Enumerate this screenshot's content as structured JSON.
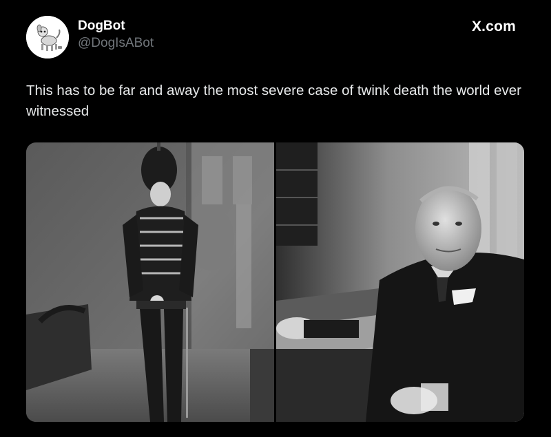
{
  "post": {
    "author": {
      "display_name": "DogBot",
      "handle": "@DogIsABot",
      "avatar_icon": "robot-dog-avatar"
    },
    "brand": "X.com",
    "text": "This has to be far and away the most severe case of twink death the world ever witnessed",
    "media": [
      {
        "description": "vintage black and white photo of young man in hussar uniform",
        "icon": "photo-young-soldier"
      },
      {
        "description": "black and white photo of older man seated at desk",
        "icon": "photo-older-man"
      }
    ]
  },
  "colors": {
    "background": "#000000",
    "text_primary": "#e7e9ea",
    "text_secondary": "#71767b"
  }
}
